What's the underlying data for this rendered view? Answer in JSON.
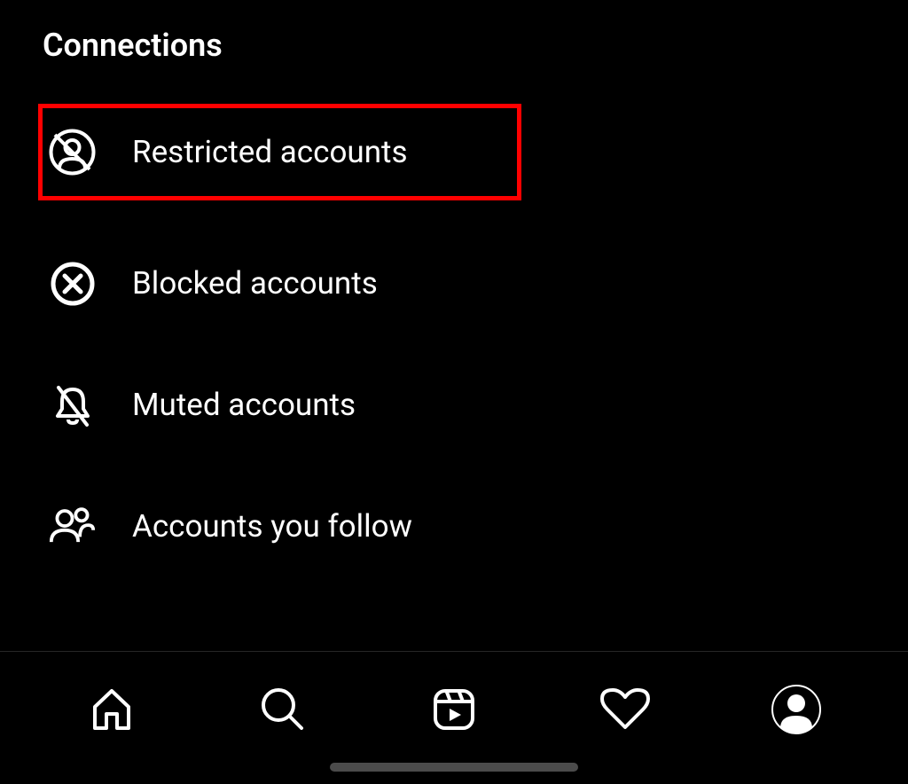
{
  "section_title": "Connections",
  "menu_items": [
    {
      "label": "Restricted accounts",
      "icon_name": "restricted-icon",
      "highlighted": true
    },
    {
      "label": "Blocked accounts",
      "icon_name": "blocked-icon",
      "highlighted": false
    },
    {
      "label": "Muted accounts",
      "icon_name": "muted-icon",
      "highlighted": false
    },
    {
      "label": "Accounts you follow",
      "icon_name": "follow-icon",
      "highlighted": false
    }
  ],
  "nav_items": [
    {
      "name": "home-icon"
    },
    {
      "name": "search-icon"
    },
    {
      "name": "reels-icon"
    },
    {
      "name": "activity-icon"
    },
    {
      "name": "profile-icon"
    }
  ]
}
